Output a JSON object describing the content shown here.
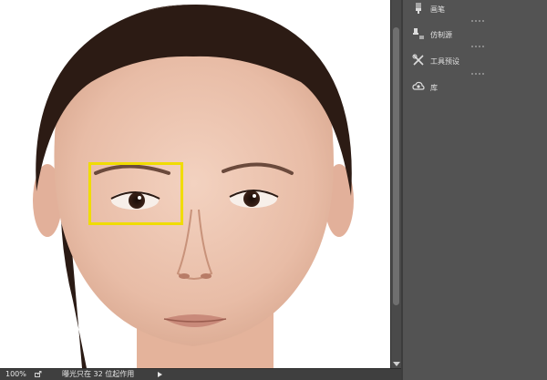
{
  "canvas": {
    "selection_color": "#f0dc00"
  },
  "statusbar": {
    "zoom": "100%",
    "share_icon": "export-icon",
    "message": "曝光只在 32 位起作用"
  },
  "panels": [
    {
      "label": "画笔",
      "icon": "brush-icon"
    },
    {
      "label": "仿制源",
      "icon": "clone-source-icon"
    },
    {
      "label": "工具预设",
      "icon": "tool-presets-icon"
    },
    {
      "label": "库",
      "icon": "libraries-icon"
    }
  ]
}
